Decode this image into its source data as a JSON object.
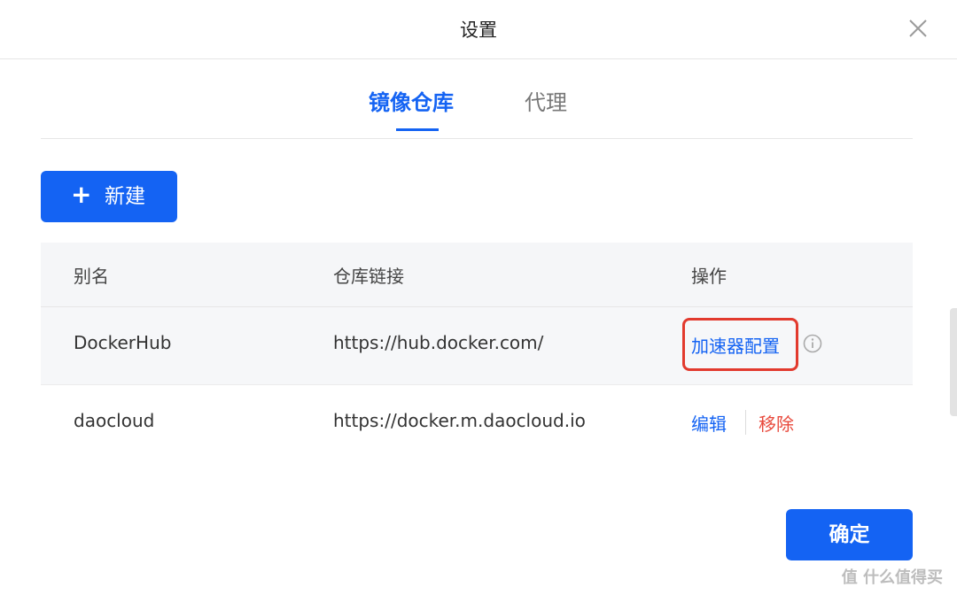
{
  "header": {
    "title": "设置"
  },
  "tabs": [
    {
      "label": "镜像仓库",
      "active": true
    },
    {
      "label": "代理",
      "active": false
    }
  ],
  "toolbar": {
    "new_label": "新建"
  },
  "table": {
    "columns": [
      "别名",
      "仓库链接",
      "操作"
    ],
    "rows": [
      {
        "alias": "DockerHub",
        "url": "https://hub.docker.com/",
        "action": "加速器配置"
      },
      {
        "alias": "daocloud",
        "url": "https://docker.m.daocloud.io",
        "edit": "编辑",
        "remove": "移除"
      }
    ]
  },
  "footer": {
    "confirm_label": "确定"
  },
  "watermark": {
    "text": "值 什么值得买"
  },
  "colors": {
    "primary": "#1463f3",
    "danger": "#e8483b",
    "highlight": "#e23a2e"
  }
}
